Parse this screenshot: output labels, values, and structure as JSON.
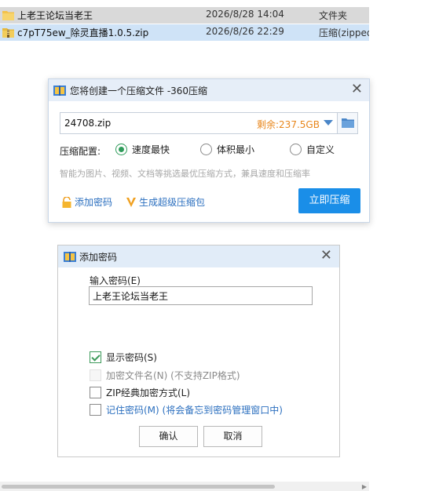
{
  "explorer": {
    "files": [
      {
        "name": "上老王论坛当老王",
        "date": "2026/8/28 14:04",
        "type": "文件夹",
        "icon": "folder-icon"
      },
      {
        "name": "c7pT75ew_除灵直播1.0.5.zip",
        "date": "2026/8/26 22:29",
        "type": "压缩(zipped",
        "icon": "zip-file-icon"
      }
    ]
  },
  "zip_dialog": {
    "title": "您将创建一个压缩文件 -360压缩",
    "filename": "24708.zip",
    "free_space": "剩余:237.5GB",
    "config_label": "压缩配置:",
    "options": [
      "速度最快",
      "体积最小",
      "自定义"
    ],
    "selected_option": "速度最快",
    "hint": "智能为图片、视频、文档等挑选最优压缩方式，兼具速度和压缩率",
    "add_password": "添加密码",
    "super_pack": "生成超级压缩包",
    "compress_button": "立即压缩",
    "colors": {
      "accent": "#1a8ee8",
      "free_space": "#e8861b",
      "link": "#2b6fbf"
    }
  },
  "pw_dialog": {
    "title": "添加密码",
    "input_label": "输入密码(E)",
    "password_value": "上老王论坛当老王",
    "checkboxes": [
      {
        "label": "显示密码(S)",
        "checked": true,
        "disabled": false
      },
      {
        "label": "加密文件名(N) (不支持ZIP格式)",
        "checked": false,
        "disabled": true
      },
      {
        "label": "ZIP经典加密方式(L)",
        "checked": false,
        "disabled": false
      },
      {
        "label": "记住密码(M) (将会备忘到密码管理窗口中)",
        "checked": false,
        "disabled": false
      }
    ],
    "ok": "确认",
    "cancel": "取消"
  }
}
